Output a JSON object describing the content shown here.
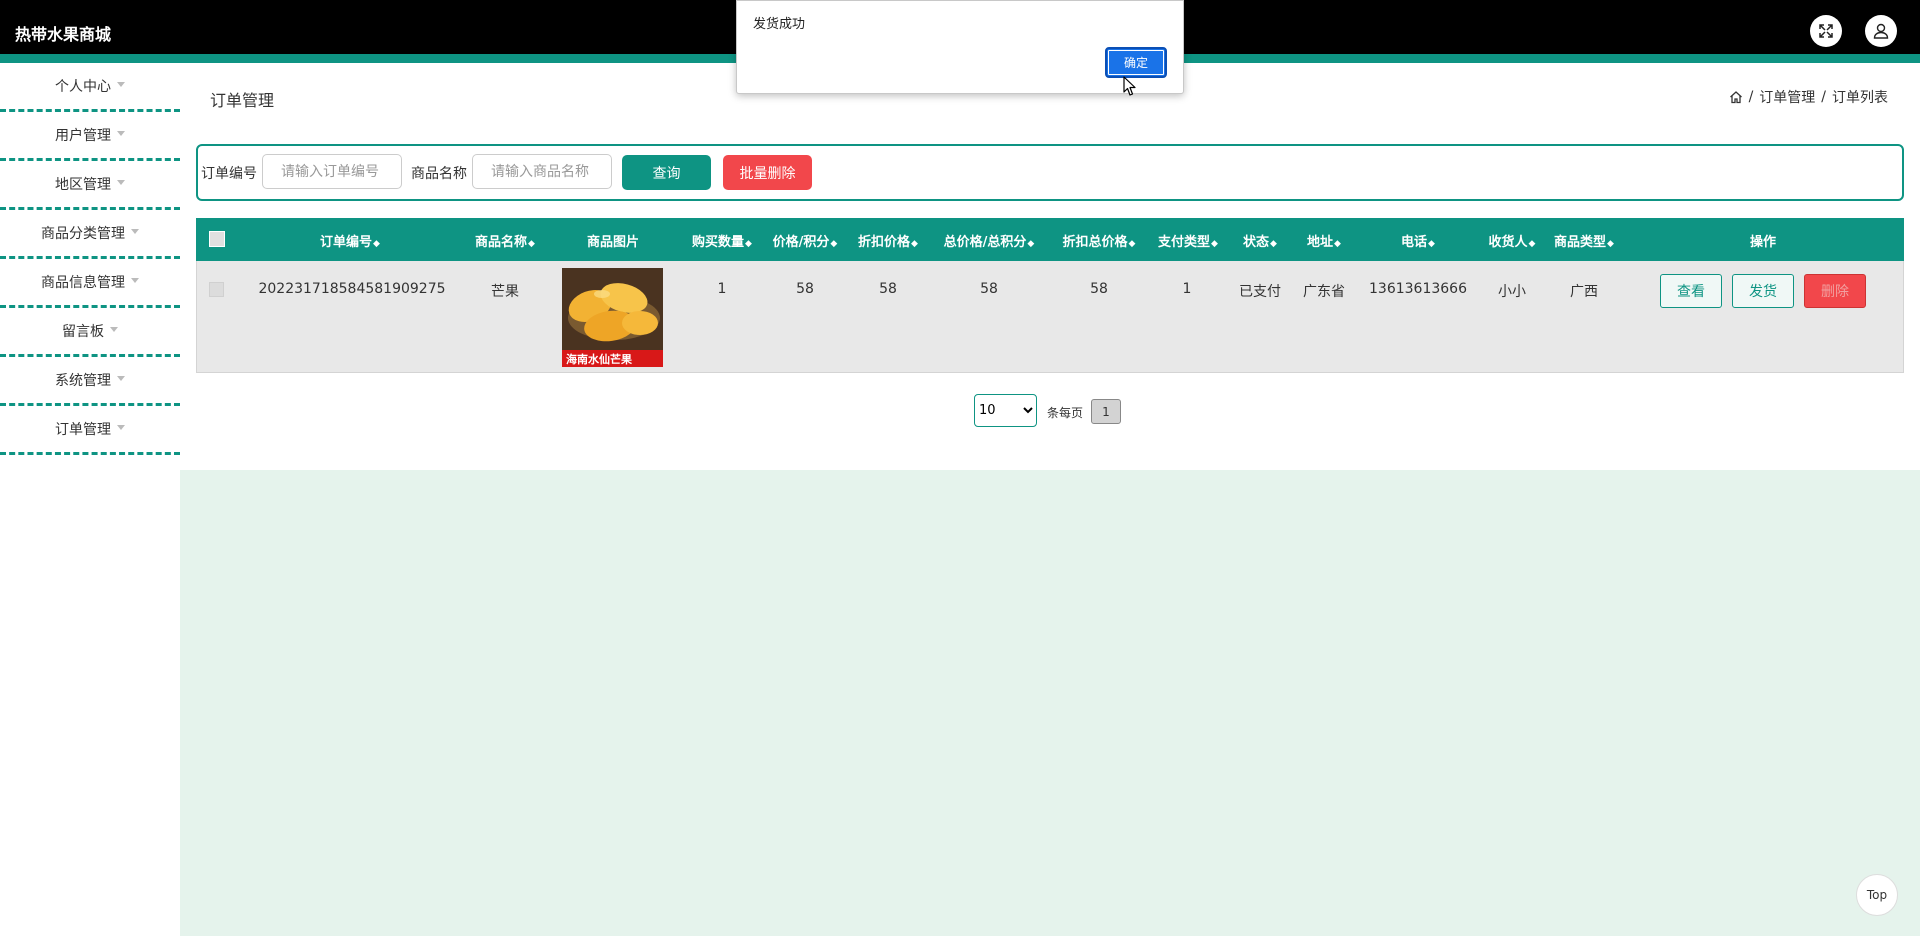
{
  "app": {
    "title": "热带水果商城"
  },
  "sidebar": {
    "items": [
      {
        "label": "个人中心"
      },
      {
        "label": "用户管理"
      },
      {
        "label": "地区管理"
      },
      {
        "label": "商品分类管理"
      },
      {
        "label": "商品信息管理"
      },
      {
        "label": "留言板"
      },
      {
        "label": "系统管理"
      },
      {
        "label": "订单管理"
      }
    ]
  },
  "page": {
    "title": "订单管理"
  },
  "breadcrumb": {
    "items": [
      "订单管理",
      "订单列表"
    ],
    "separator": "/"
  },
  "search": {
    "order_label": "订单编号",
    "order_placeholder": "请输入订单编号",
    "product_label": "商品名称",
    "product_placeholder": "请输入商品名称",
    "query_button": "查询",
    "batch_delete_button": "批量删除"
  },
  "table": {
    "columns": [
      "订单编号",
      "商品名称",
      "商品图片",
      "购买数量",
      "价格/积分",
      "折扣价格",
      "总价格/总积分",
      "折扣总价格",
      "支付类型",
      "状态",
      "地址",
      "电话",
      "收货人",
      "商品类型",
      "操作"
    ],
    "rows": [
      {
        "order_no": "202231718584581909275",
        "product_name": "芒果",
        "image_caption": "海南水仙芒果",
        "quantity": "1",
        "price": "58",
        "discount_price": "58",
        "total_price": "58",
        "discount_total": "58",
        "pay_type": "1",
        "status": "已支付",
        "address": "广东省",
        "phone": "13613613666",
        "receiver": "小小",
        "product_type": "广西",
        "actions": {
          "view": "查看",
          "ship": "发货",
          "delete": "删除"
        }
      }
    ]
  },
  "pagination": {
    "page_size": "10",
    "page_size_options": [
      "10"
    ],
    "per_page_label": "条每页",
    "current_page": "1"
  },
  "dialog": {
    "message": "发货成功",
    "ok_button": "确定"
  },
  "back_to_top": "Top",
  "colors": {
    "primary": "#0e9483",
    "danger": "#f2474b",
    "topbar": "#000000",
    "main_bg": "#e5f3ec"
  }
}
